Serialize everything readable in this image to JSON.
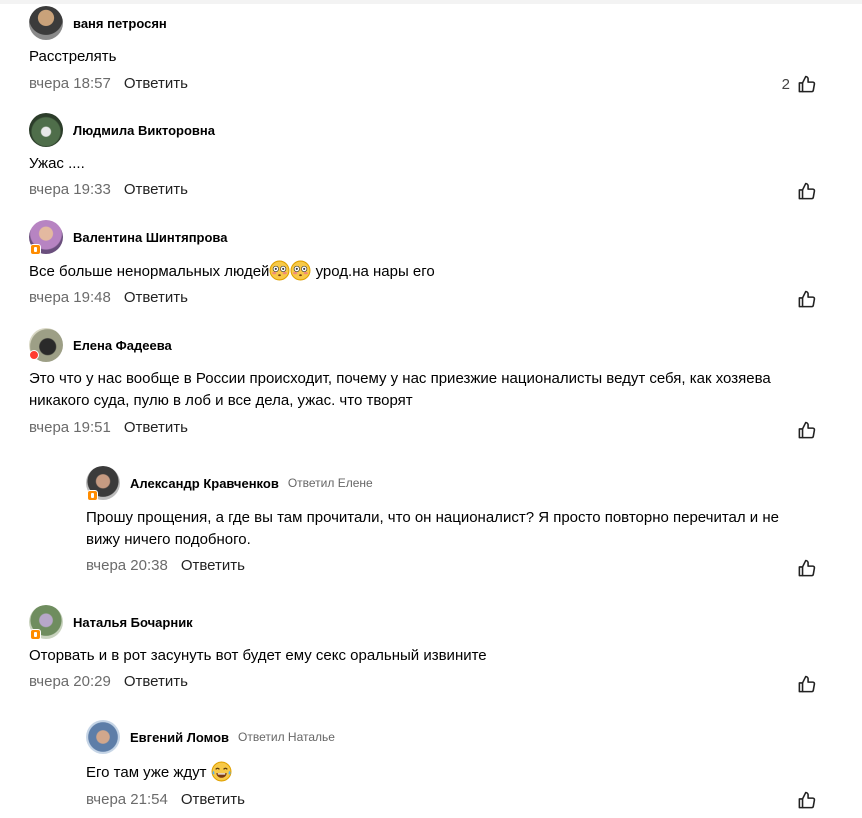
{
  "reply_label": "Ответить",
  "comments": [
    {
      "author": "ваня петросян",
      "text": "Расстрелять",
      "time": "вчера 18:57",
      "likes": "2"
    },
    {
      "author": "Людмила Викторовна",
      "text": "Ужас ....",
      "time": "вчера 19:33",
      "likes": ""
    },
    {
      "author": "Валентина Шинтяпрова",
      "text_before": "Все больше ненормальных людей",
      "text_after": " урод.на нары его",
      "time": "вчера 19:48",
      "likes": ""
    },
    {
      "author": "Елена Фадеева",
      "text": "Это что у нас вообще в России происходит, почему у нас приезжие националисты ведут себя, как хозяева никакого суда, пулю в лоб и все дела, ужас. что творят",
      "time": "вчера 19:51",
      "likes": ""
    },
    {
      "author": "Александр Кравченков",
      "replied_to": "Ответил Елене",
      "text": "Прошу прощения, а где вы там прочитали, что он националист? Я просто повторно перечитал и не вижу ничего подобного.",
      "time": "вчера 20:38",
      "likes": ""
    },
    {
      "author": "Наталья Бочарник",
      "text": "Оторвать и в рот засунуть вот будет ему секс оральный извините",
      "time": "вчера 20:29",
      "likes": ""
    },
    {
      "author": "Евгений Ломов",
      "replied_to": "Ответил Наталье",
      "text": "Его там уже ждут",
      "time": "вчера 21:54",
      "likes": ""
    }
  ],
  "colors": {
    "badge": "#ff8c00",
    "muted": "#6b6b6b"
  },
  "icons": {
    "like": "thumbs-up-icon",
    "flushed": "flushed-face-emoji",
    "laughing": "tears-of-joy-emoji"
  }
}
